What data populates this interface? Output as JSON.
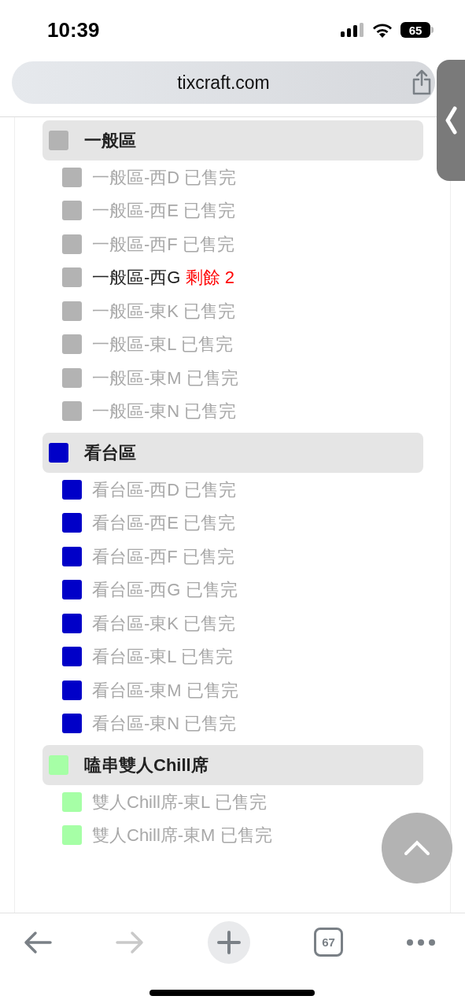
{
  "status_bar": {
    "time": "10:39",
    "battery": "65"
  },
  "address_bar": {
    "url": "tixcraft.com"
  },
  "groups": [
    {
      "title": "一般區",
      "color": "#b3b3b3",
      "areas": [
        {
          "name": "一般區-西D",
          "status": "已售完",
          "available": false
        },
        {
          "name": "一般區-西E",
          "status": "已售完",
          "available": false
        },
        {
          "name": "一般區-西F",
          "status": "已售完",
          "available": false
        },
        {
          "name": "一般區-西G",
          "status": "剩餘 2",
          "available": true
        },
        {
          "name": "一般區-東K",
          "status": "已售完",
          "available": false
        },
        {
          "name": "一般區-東L",
          "status": "已售完",
          "available": false
        },
        {
          "name": "一般區-東M",
          "status": "已售完",
          "available": false
        },
        {
          "name": "一般區-東N",
          "status": "已售完",
          "available": false
        }
      ]
    },
    {
      "title": "看台區",
      "color": "#0000c8",
      "areas": [
        {
          "name": "看台區-西D",
          "status": "已售完",
          "available": false
        },
        {
          "name": "看台區-西E",
          "status": "已售完",
          "available": false
        },
        {
          "name": "看台區-西F",
          "status": "已售完",
          "available": false
        },
        {
          "name": "看台區-西G",
          "status": "已售完",
          "available": false
        },
        {
          "name": "看台區-東K",
          "status": "已售完",
          "available": false
        },
        {
          "name": "看台區-東L",
          "status": "已售完",
          "available": false
        },
        {
          "name": "看台區-東M",
          "status": "已售完",
          "available": false
        },
        {
          "name": "看台區-東N",
          "status": "已售完",
          "available": false
        }
      ]
    },
    {
      "title": "嗑串雙人Chill席",
      "color": "#a6ffa6",
      "areas": [
        {
          "name": "雙人Chill席-東L",
          "status": "已售完",
          "available": false
        },
        {
          "name": "雙人Chill席-東M",
          "status": "已售完",
          "available": false
        }
      ]
    }
  ],
  "toolbar": {
    "tab_count": "67"
  }
}
